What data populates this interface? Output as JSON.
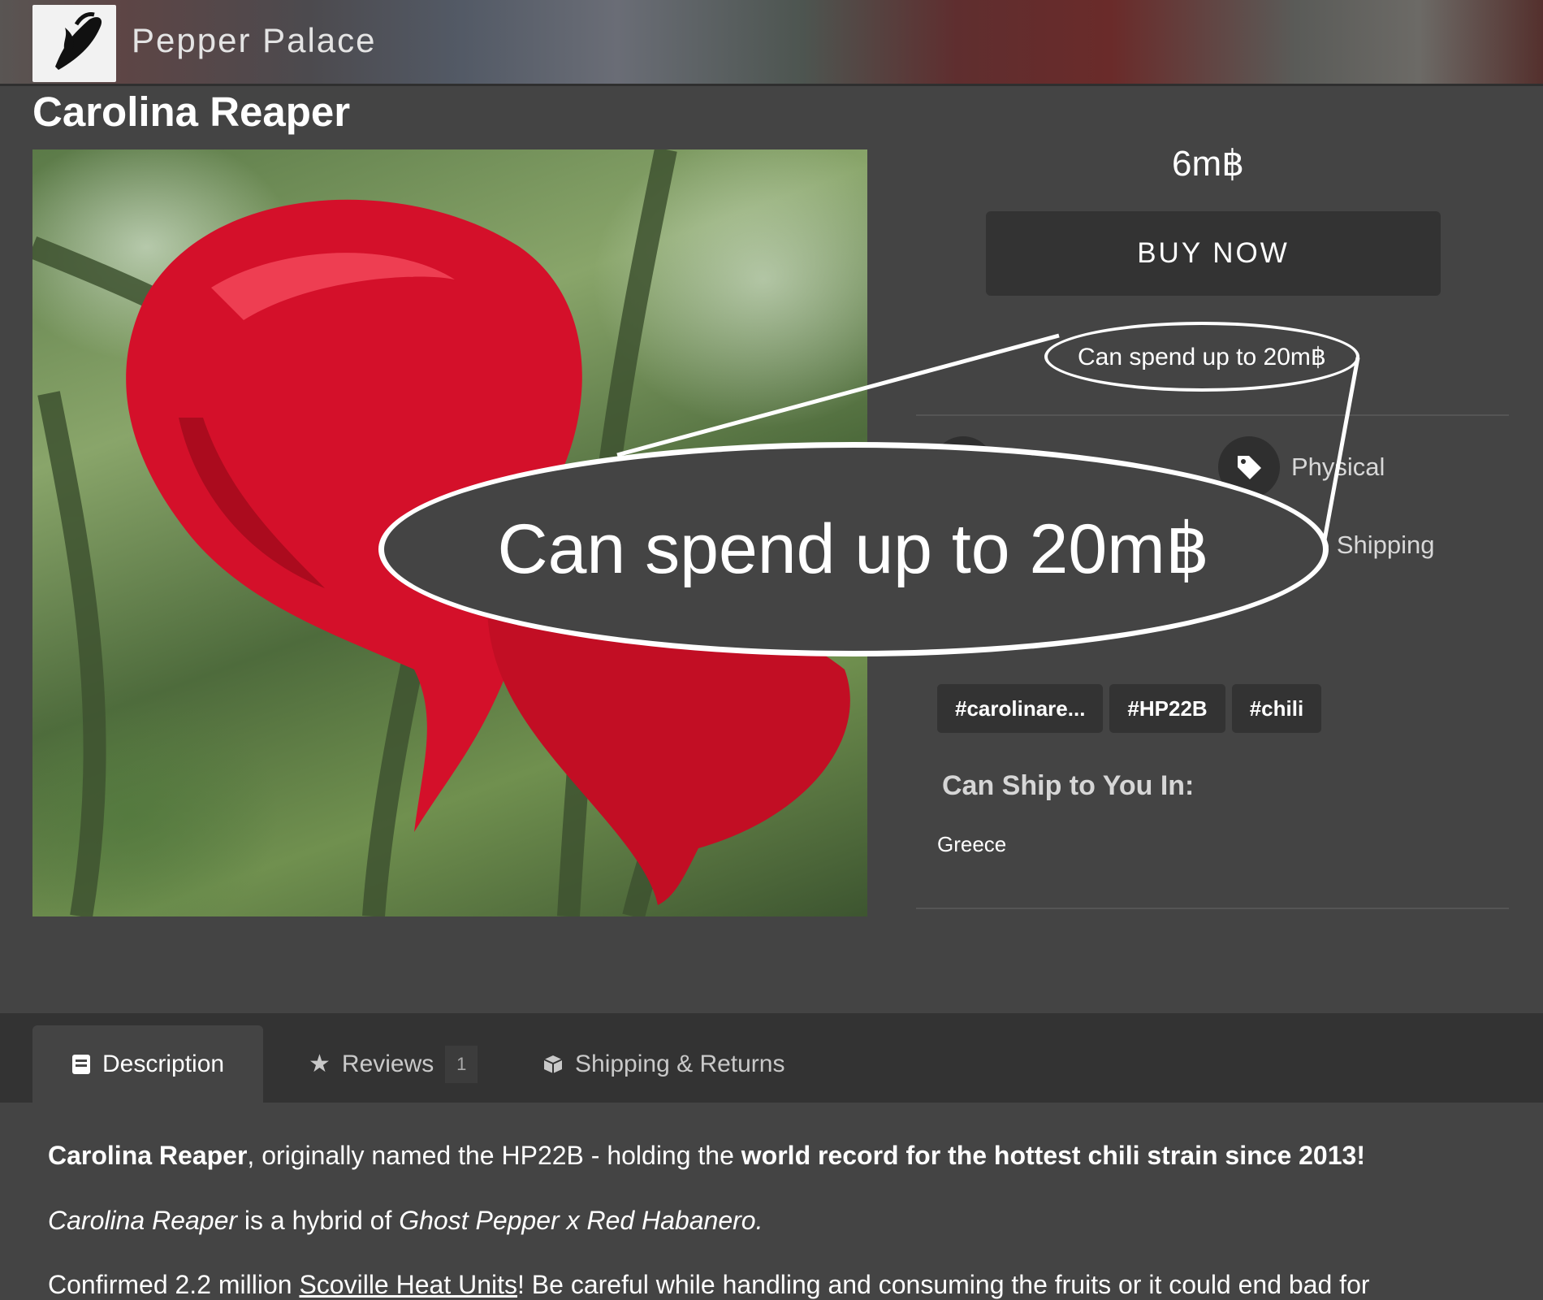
{
  "header": {
    "store_name": "Pepper Palace"
  },
  "product": {
    "title": "Carolina Reaper",
    "price": "6m฿",
    "buy_label": "BUY NOW",
    "spend_limit": "Can spend up to 20m฿",
    "type": "Physical",
    "shipping": "e Shipping",
    "tags": [
      "#carolinare...",
      "#HP22B",
      "#chili"
    ],
    "ship_heading": "Can Ship to You In:",
    "ship_country": "Greece"
  },
  "callout": {
    "text": "Can spend up to 20m฿"
  },
  "tabs": {
    "description": "Description",
    "reviews": "Reviews",
    "reviews_count": "1",
    "shipping": "Shipping & Returns"
  },
  "description": {
    "p1_a": "Carolina Reaper",
    "p1_b": ", originally named the HP22B - holding the ",
    "p1_c": "world record for the hottest chili strain since 2013!",
    "p2_a": "Carolina Reaper",
    "p2_b": " is a hybrid of ",
    "p2_c": "Ghost Pepper x Red Habanero.",
    "p3_a": "Confirmed 2.2 million ",
    "p3_link": "Scoville Heat Units",
    "p3_b": "! Be careful while handling and consuming the fruits or it could end bad for"
  },
  "icons": [
    "pepper-logo-icon",
    "tag-icon",
    "star-icon",
    "document-icon",
    "package-icon"
  ]
}
